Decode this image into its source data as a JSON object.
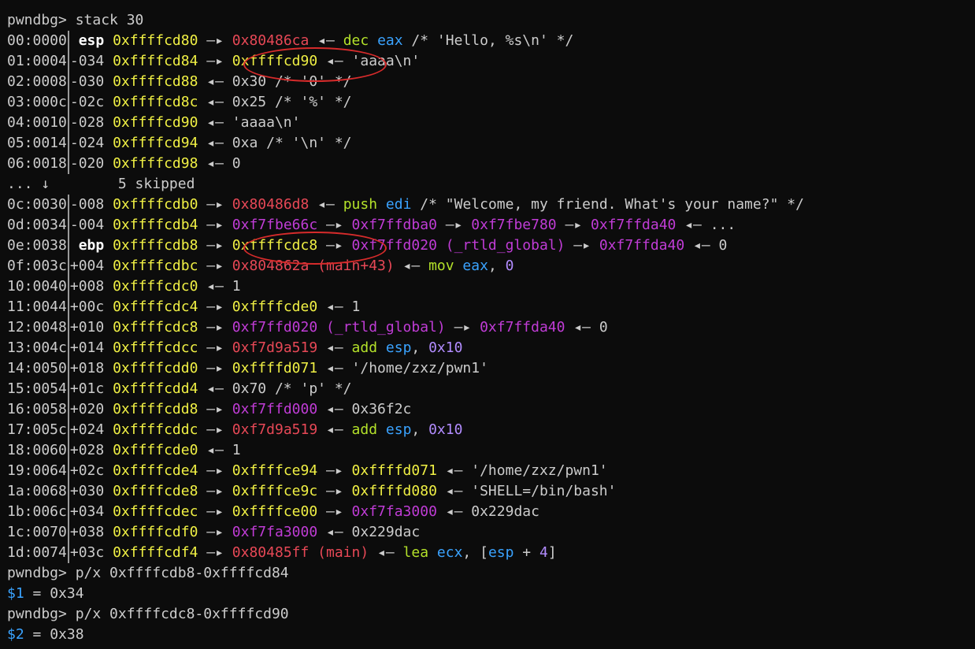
{
  "colors": {
    "background": "#0c0c0c",
    "text": "#cccccc",
    "prompt": "#16c60c",
    "address_stack": "#f0f044",
    "address_code": "#e74856",
    "address_data": "#c03cd6",
    "mnemonic": "#b4e22a",
    "register": "#3aa3ff",
    "immediate": "#b28cff",
    "annotation_ellipse": "#d62b2b"
  },
  "lines": [
    {
      "segments": [
        {
          "t": "pwndbg> ",
          "c": "prompt"
        },
        {
          "t": "stack 30",
          "c": "white"
        }
      ]
    },
    {
      "off": "00:0000",
      "rel": " esp",
      "segments": [
        {
          "t": " "
        },
        {
          "t": "0xffffcd80",
          "c": "yellow"
        },
        {
          "t": " —▸ "
        },
        {
          "t": "0x80486ca",
          "c": "red"
        },
        {
          "t": " ◂— "
        },
        {
          "t": "dec",
          "c": "green"
        },
        {
          "t": " "
        },
        {
          "t": "eax",
          "c": "cyan"
        },
        {
          "t": " /* 'Hello, %s\\n' */"
        }
      ]
    },
    {
      "off": "01:0004",
      "rel": "-034",
      "segments": [
        {
          "t": " "
        },
        {
          "t": "0xffffcd84",
          "c": "yellow"
        },
        {
          "t": " —▸ "
        },
        {
          "t": "0xffffcd90",
          "c": "yellow"
        },
        {
          "t": " ◂— 'aaaa\\n'"
        }
      ]
    },
    {
      "off": "02:0008",
      "rel": "-030",
      "segments": [
        {
          "t": " "
        },
        {
          "t": "0xffffcd88",
          "c": "yellow"
        },
        {
          "t": " ◂— 0x30 /* '0' */"
        }
      ]
    },
    {
      "off": "03:000c",
      "rel": "-02c",
      "segments": [
        {
          "t": " "
        },
        {
          "t": "0xffffcd8c",
          "c": "yellow"
        },
        {
          "t": " ◂— 0x25 /* '%' */"
        }
      ]
    },
    {
      "off": "04:0010",
      "rel": "-028",
      "segments": [
        {
          "t": " "
        },
        {
          "t": "0xffffcd90",
          "c": "yellow"
        },
        {
          "t": " ◂— 'aaaa\\n'"
        }
      ]
    },
    {
      "off": "05:0014",
      "rel": "-024",
      "segments": [
        {
          "t": " "
        },
        {
          "t": "0xffffcd94",
          "c": "yellow"
        },
        {
          "t": " ◂— 0xa /* '\\n' */"
        }
      ]
    },
    {
      "off": "06:0018",
      "rel": "-020",
      "segments": [
        {
          "t": " "
        },
        {
          "t": "0xffffcd98",
          "c": "yellow"
        },
        {
          "t": " ◂— 0"
        }
      ]
    },
    {
      "segments": [
        {
          "t": "... ↓        5 skipped",
          "c": "white"
        }
      ]
    },
    {
      "off": "0c:0030",
      "rel": "-008",
      "segments": [
        {
          "t": " "
        },
        {
          "t": "0xffffcdb0",
          "c": "yellow"
        },
        {
          "t": " —▸ "
        },
        {
          "t": "0x80486d8",
          "c": "red"
        },
        {
          "t": " ◂— "
        },
        {
          "t": "push",
          "c": "green"
        },
        {
          "t": " "
        },
        {
          "t": "edi",
          "c": "cyan"
        },
        {
          "t": " /* \"Welcome, my friend. What's your name?\" */"
        }
      ]
    },
    {
      "off": "0d:0034",
      "rel": "-004",
      "segments": [
        {
          "t": " "
        },
        {
          "t": "0xffffcdb4",
          "c": "yellow"
        },
        {
          "t": " —▸ "
        },
        {
          "t": "0xf7fbe66c",
          "c": "magenta"
        },
        {
          "t": " —▸ "
        },
        {
          "t": "0xf7ffdba0",
          "c": "magenta"
        },
        {
          "t": " —▸ "
        },
        {
          "t": "0xf7fbe780",
          "c": "magenta"
        },
        {
          "t": " —▸ "
        },
        {
          "t": "0xf7ffda40",
          "c": "magenta"
        },
        {
          "t": " ◂— ..."
        }
      ]
    },
    {
      "off": "0e:0038",
      "rel": " ebp",
      "segments": [
        {
          "t": " "
        },
        {
          "t": "0xffffcdb8",
          "c": "yellow"
        },
        {
          "t": " —▸ "
        },
        {
          "t": "0xffffcdc8",
          "c": "yellow"
        },
        {
          "t": " —▸ "
        },
        {
          "t": "0xf7ffd020 (_rtld_global)",
          "c": "magenta"
        },
        {
          "t": " —▸ "
        },
        {
          "t": "0xf7ffda40",
          "c": "magenta"
        },
        {
          "t": " ◂— 0"
        }
      ]
    },
    {
      "off": "0f:003c",
      "rel": "+004",
      "segments": [
        {
          "t": " "
        },
        {
          "t": "0xffffcdbc",
          "c": "yellow"
        },
        {
          "t": " —▸ "
        },
        {
          "t": "0x804862a (main+43)",
          "c": "red"
        },
        {
          "t": " ◂— "
        },
        {
          "t": "mov",
          "c": "green"
        },
        {
          "t": " "
        },
        {
          "t": "eax",
          "c": "cyan"
        },
        {
          "t": ", "
        },
        {
          "t": "0",
          "c": "purple"
        }
      ]
    },
    {
      "off": "10:0040",
      "rel": "+008",
      "segments": [
        {
          "t": " "
        },
        {
          "t": "0xffffcdc0",
          "c": "yellow"
        },
        {
          "t": " ◂— 1"
        }
      ]
    },
    {
      "off": "11:0044",
      "rel": "+00c",
      "segments": [
        {
          "t": " "
        },
        {
          "t": "0xffffcdc4",
          "c": "yellow"
        },
        {
          "t": " —▸ "
        },
        {
          "t": "0xffffcde0",
          "c": "yellow"
        },
        {
          "t": " ◂— 1"
        }
      ]
    },
    {
      "off": "12:0048",
      "rel": "+010",
      "segments": [
        {
          "t": " "
        },
        {
          "t": "0xffffcdc8",
          "c": "yellow"
        },
        {
          "t": " —▸ "
        },
        {
          "t": "0xf7ffd020 (_rtld_global)",
          "c": "magenta"
        },
        {
          "t": " —▸ "
        },
        {
          "t": "0xf7ffda40",
          "c": "magenta"
        },
        {
          "t": " ◂— 0"
        }
      ]
    },
    {
      "off": "13:004c",
      "rel": "+014",
      "segments": [
        {
          "t": " "
        },
        {
          "t": "0xffffcdcc",
          "c": "yellow"
        },
        {
          "t": " —▸ "
        },
        {
          "t": "0xf7d9a519",
          "c": "red"
        },
        {
          "t": " ◂— "
        },
        {
          "t": "add",
          "c": "green"
        },
        {
          "t": " "
        },
        {
          "t": "esp",
          "c": "cyan"
        },
        {
          "t": ", "
        },
        {
          "t": "0x10",
          "c": "purple"
        }
      ]
    },
    {
      "off": "14:0050",
      "rel": "+018",
      "segments": [
        {
          "t": " "
        },
        {
          "t": "0xffffcdd0",
          "c": "yellow"
        },
        {
          "t": " —▸ "
        },
        {
          "t": "0xffffd071",
          "c": "yellow"
        },
        {
          "t": " ◂— '/home/zxz/pwn1'"
        }
      ]
    },
    {
      "off": "15:0054",
      "rel": "+01c",
      "segments": [
        {
          "t": " "
        },
        {
          "t": "0xffffcdd4",
          "c": "yellow"
        },
        {
          "t": " ◂— 0x70 /* 'p' */"
        }
      ]
    },
    {
      "off": "16:0058",
      "rel": "+020",
      "segments": [
        {
          "t": " "
        },
        {
          "t": "0xffffcdd8",
          "c": "yellow"
        },
        {
          "t": " —▸ "
        },
        {
          "t": "0xf7ffd000",
          "c": "magenta"
        },
        {
          "t": " ◂— 0x36f2c"
        }
      ]
    },
    {
      "off": "17:005c",
      "rel": "+024",
      "segments": [
        {
          "t": " "
        },
        {
          "t": "0xffffcddc",
          "c": "yellow"
        },
        {
          "t": " —▸ "
        },
        {
          "t": "0xf7d9a519",
          "c": "red"
        },
        {
          "t": " ◂— "
        },
        {
          "t": "add",
          "c": "green"
        },
        {
          "t": " "
        },
        {
          "t": "esp",
          "c": "cyan"
        },
        {
          "t": ", "
        },
        {
          "t": "0x10",
          "c": "purple"
        }
      ]
    },
    {
      "off": "18:0060",
      "rel": "+028",
      "segments": [
        {
          "t": " "
        },
        {
          "t": "0xffffcde0",
          "c": "yellow"
        },
        {
          "t": " ◂— 1"
        }
      ]
    },
    {
      "off": "19:0064",
      "rel": "+02c",
      "segments": [
        {
          "t": " "
        },
        {
          "t": "0xffffcde4",
          "c": "yellow"
        },
        {
          "t": " —▸ "
        },
        {
          "t": "0xffffce94",
          "c": "yellow"
        },
        {
          "t": " —▸ "
        },
        {
          "t": "0xffffd071",
          "c": "yellow"
        },
        {
          "t": " ◂— '/home/zxz/pwn1'"
        }
      ]
    },
    {
      "off": "1a:0068",
      "rel": "+030",
      "segments": [
        {
          "t": " "
        },
        {
          "t": "0xffffcde8",
          "c": "yellow"
        },
        {
          "t": " —▸ "
        },
        {
          "t": "0xffffce9c",
          "c": "yellow"
        },
        {
          "t": " —▸ "
        },
        {
          "t": "0xffffd080",
          "c": "yellow"
        },
        {
          "t": " ◂— 'SHELL=/bin/bash'"
        }
      ]
    },
    {
      "off": "1b:006c",
      "rel": "+034",
      "segments": [
        {
          "t": " "
        },
        {
          "t": "0xffffcdec",
          "c": "yellow"
        },
        {
          "t": " —▸ "
        },
        {
          "t": "0xffffce00",
          "c": "yellow"
        },
        {
          "t": " —▸ "
        },
        {
          "t": "0xf7fa3000",
          "c": "magenta"
        },
        {
          "t": " ◂— 0x229dac"
        }
      ]
    },
    {
      "off": "1c:0070",
      "rel": "+038",
      "segments": [
        {
          "t": " "
        },
        {
          "t": "0xffffcdf0",
          "c": "yellow"
        },
        {
          "t": " —▸ "
        },
        {
          "t": "0xf7fa3000",
          "c": "magenta"
        },
        {
          "t": " ◂— 0x229dac"
        }
      ]
    },
    {
      "off": "1d:0074",
      "rel": "+03c",
      "segments": [
        {
          "t": " "
        },
        {
          "t": "0xffffcdf4",
          "c": "yellow"
        },
        {
          "t": " —▸ "
        },
        {
          "t": "0x80485ff (main)",
          "c": "red"
        },
        {
          "t": " ◂— "
        },
        {
          "t": "lea",
          "c": "green"
        },
        {
          "t": " "
        },
        {
          "t": "ecx",
          "c": "cyan"
        },
        {
          "t": ", ["
        },
        {
          "t": "esp",
          "c": "cyan"
        },
        {
          "t": " + "
        },
        {
          "t": "4",
          "c": "purple"
        },
        {
          "t": "]"
        }
      ]
    },
    {
      "segments": [
        {
          "t": "pwndbg> ",
          "c": "prompt"
        },
        {
          "t": "p/x 0xffffcdb8-0xffffcd84",
          "c": "white"
        }
      ]
    },
    {
      "segments": [
        {
          "t": "$1",
          "c": "cyan"
        },
        {
          "t": " = 0x34"
        }
      ]
    },
    {
      "segments": [
        {
          "t": "pwndbg> ",
          "c": "prompt"
        },
        {
          "t": "p/x 0xffffcdc8-0xffffcd90",
          "c": "white"
        }
      ]
    },
    {
      "segments": [
        {
          "t": "$2",
          "c": "cyan"
        },
        {
          "t": " = 0x38"
        }
      ]
    }
  ]
}
